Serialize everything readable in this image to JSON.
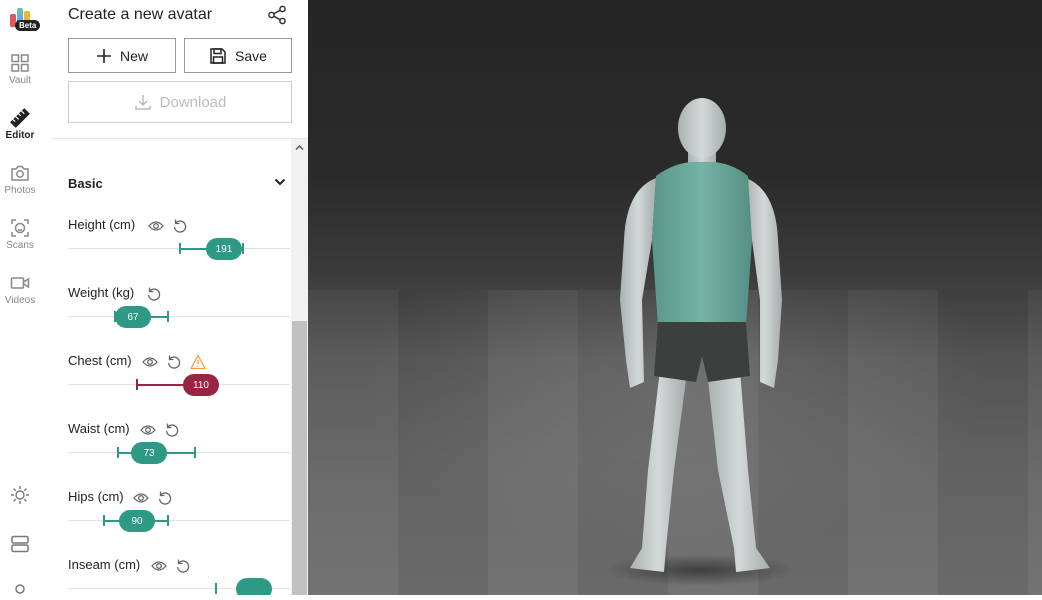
{
  "rail": {
    "beta": "Beta",
    "items": [
      {
        "label": "Vault",
        "icon": "grid-icon"
      },
      {
        "label": "Editor",
        "icon": "ruler-icon"
      },
      {
        "label": "Photos",
        "icon": "camera-icon"
      },
      {
        "label": "Scans",
        "icon": "scan-face-icon"
      },
      {
        "label": "Videos",
        "icon": "video-icon"
      }
    ],
    "bottom_icons": [
      "sun-icon",
      "layers-icon",
      "circle-icon"
    ]
  },
  "panel": {
    "title": "Create a new avatar",
    "new_label": "New",
    "save_label": "Save",
    "download_label": "Download",
    "section_title": "Basic"
  },
  "measurements": [
    {
      "label": "Height (cm)",
      "value": "191",
      "warning": false
    },
    {
      "label": "Weight (kg)",
      "value": "67",
      "warning": false
    },
    {
      "label": "Chest (cm)",
      "value": "110",
      "warning": true
    },
    {
      "label": "Waist (cm)",
      "value": "73",
      "warning": false
    },
    {
      "label": "Hips (cm)",
      "value": "90",
      "warning": false
    },
    {
      "label": "Inseam (cm)",
      "value": "",
      "warning": false
    }
  ],
  "colors": {
    "accent": "#2e9a85",
    "warning": "#9a2444",
    "shirt": "#6aa79a",
    "shorts": "#3a3f3e",
    "skin": "#c9d0cf"
  }
}
